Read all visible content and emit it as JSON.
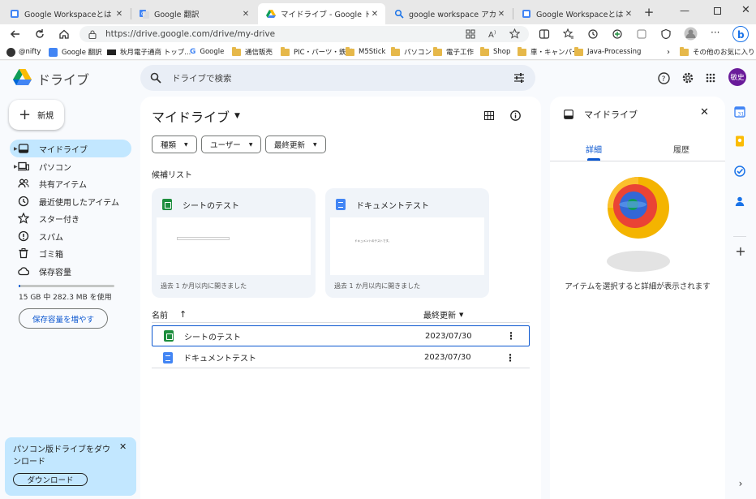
{
  "browser": {
    "tabs": [
      {
        "title": "Google Workspaceとは｜Google",
        "icon": "workspace-icon"
      },
      {
        "title": "Google 翻訳",
        "icon": "translate-icon"
      },
      {
        "title": "マイドライブ - Google ドライブ",
        "icon": "drive-icon",
        "active": true
      },
      {
        "title": "google workspace アカウント 無料",
        "icon": "search-icon"
      },
      {
        "title": "Google Workspaceとは｜Google",
        "icon": "workspace-icon"
      }
    ],
    "new_tab": "+",
    "url": "https://drive.google.com/drive/my-drive",
    "bookmarks": [
      "@nifty",
      "Google 翻訳",
      "秋月電子通商 トップ...",
      "Google",
      "通信販売",
      "PIC・パーツ・鉄道",
      "M5Stick",
      "パソコン",
      "電子工作",
      "Shop",
      "車・キャンパー",
      "Java-Processing"
    ],
    "other_favorites": "その他のお気に入り"
  },
  "app": {
    "name": "ドライブ",
    "search_placeholder": "ドライブで検索",
    "avatar_text": "敏史",
    "new_button": "新規",
    "nav": [
      {
        "label": "マイドライブ",
        "icon": "my-drive-icon",
        "active": true,
        "caret": true
      },
      {
        "label": "パソコン",
        "icon": "computer-icon",
        "caret": true
      },
      {
        "label": "共有アイテム",
        "icon": "shared-icon"
      },
      {
        "label": "最近使用したアイテム",
        "icon": "clock-icon"
      },
      {
        "label": "スター付き",
        "icon": "star-icon"
      },
      {
        "label": "スパム",
        "icon": "spam-icon"
      },
      {
        "label": "ゴミ箱",
        "icon": "trash-icon"
      },
      {
        "label": "保存容量",
        "icon": "cloud-icon"
      }
    ],
    "storage": {
      "text": "15 GB 中 282.3 MB を使用",
      "used_fraction": 0.019
    },
    "get_more_storage": "保存容量を増やす",
    "promo": {
      "text": "パソコン版ドライブをダウンロード",
      "button": "ダウンロード"
    },
    "main": {
      "title": "マイドライブ",
      "filters": [
        "種類",
        "ユーザー",
        "最終更新"
      ],
      "suggested_label": "候補リスト",
      "cards": [
        {
          "title": "シートのテスト",
          "type": "sheet",
          "footer": "過去 1 か月以内に開きました"
        },
        {
          "title": "ドキュメントテスト",
          "type": "doc",
          "footer": "過去 1 か月以内に開きました",
          "preview_text": "ドキュメントのテストです。"
        }
      ],
      "col_name": "名前",
      "col_modified": "最終更新",
      "files": [
        {
          "name": "シートのテスト",
          "type": "sheet",
          "modified": "2023/07/30",
          "selected": true
        },
        {
          "name": "ドキュメントテスト",
          "type": "doc",
          "modified": "2023/07/30"
        }
      ]
    },
    "details": {
      "title": "マイドライブ",
      "tab_details": "詳細",
      "tab_activity": "履歴",
      "empty_text": "アイテムを選択すると詳細が表示されます"
    }
  },
  "colors": {
    "accent": "#0b57d0",
    "active_nav": "#c2e7ff",
    "promo_bg": "#c2e7ff",
    "avatar": "#6a1b9a"
  }
}
